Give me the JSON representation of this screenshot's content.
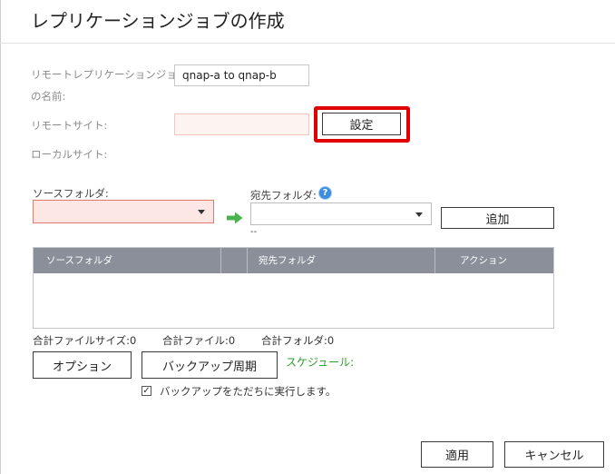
{
  "dialog": {
    "title": "レプリケーションジョブの作成"
  },
  "form": {
    "job_name_label_line1": "リモートレプリケーションジョブ",
    "job_name_label_line2": "の名前:",
    "job_name_value": "qnap-a to qnap-b",
    "remote_site_label": "リモートサイト:",
    "remote_site_value": "",
    "settings_button": "設定",
    "local_site_label": "ローカルサイト:",
    "source_folder_label": "ソースフォルダ:",
    "source_folder_value": "",
    "dest_folder_label": "宛先フォルダ:",
    "dest_folder_value": "",
    "dest_folder_hint": "--",
    "add_button": "追加"
  },
  "table": {
    "columns": [
      "ソースフォルダ",
      "",
      "宛先フォルダ",
      "アクション"
    ],
    "rows": []
  },
  "stats": {
    "total_size": "合計ファイルサイズ:0",
    "total_files": "合計ファイル:0",
    "total_folders": "合計フォルダ:0"
  },
  "actions": {
    "options_button": "オプション",
    "backup_period_button": "バックアップ周期",
    "schedule_label": "スケジュール:",
    "run_now_checkbox_label": "バックアップをただちに実行します。",
    "run_now_checked": true,
    "apply_button": "適用",
    "cancel_button": "キャンセル"
  },
  "icons": {
    "help": "help-icon",
    "arrow": "arrow-right-icon",
    "dropdown": "chevron-down-icon"
  },
  "colors": {
    "highlight": "#e00000",
    "table_header": "#8a8f99",
    "arrow": "#4cb34c",
    "schedule": "#2a9d2a",
    "help_icon": "#3c8de0",
    "error_field": "#fde7e4"
  }
}
